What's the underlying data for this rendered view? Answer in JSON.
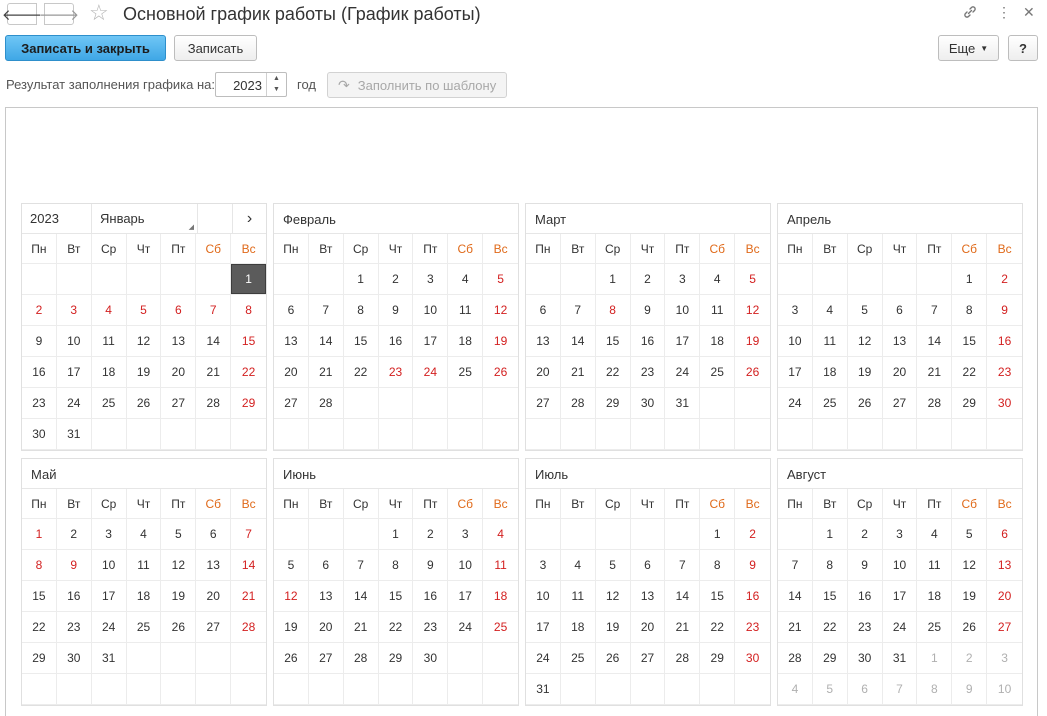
{
  "window": {
    "title": "Основной график работы (График работы)",
    "icons": [
      "back-arrow-icon",
      "forward-arrow-icon",
      "star-icon",
      "link-icon",
      "more-vertical-icon",
      "close-icon"
    ]
  },
  "toolbar": {
    "save_close_label": "Записать и закрыть",
    "save_label": "Записать",
    "more_label": "Еще",
    "help_label": "?"
  },
  "params": {
    "result_label": "Результат заполнения графика на:",
    "year_value": "2023",
    "year_unit": "год",
    "fill_button_label": "Заполнить по шаблону"
  },
  "calendar": {
    "year": "2023",
    "selected_month_label": "Январь",
    "weekdays": [
      "Пн",
      "Вт",
      "Ср",
      "Чт",
      "Пт",
      "Сб",
      "Вс"
    ],
    "colors": {
      "holiday": "#d32020",
      "weekend_header": "#e06a1a",
      "other_month": "#b0b0b0",
      "selected": "#5b5b5b"
    },
    "months": [
      {
        "name": "Январь",
        "start": 6,
        "days": 31,
        "holidays": [
          1,
          2,
          3,
          4,
          5,
          6,
          7,
          8,
          15,
          22,
          29
        ],
        "selected": 1
      },
      {
        "name": "Февраль",
        "start": 2,
        "days": 28,
        "holidays": [
          5,
          12,
          19,
          23,
          24,
          26
        ]
      },
      {
        "name": "Март",
        "start": 2,
        "days": 31,
        "holidays": [
          5,
          8,
          12,
          19,
          26
        ]
      },
      {
        "name": "Апрель",
        "start": 5,
        "days": 30,
        "holidays": [
          2,
          9,
          16,
          23,
          30
        ]
      },
      {
        "name": "Май",
        "start": 0,
        "days": 31,
        "holidays": [
          1,
          7,
          8,
          9,
          14,
          21,
          28
        ]
      },
      {
        "name": "Июнь",
        "start": 3,
        "days": 30,
        "holidays": [
          4,
          11,
          12,
          18,
          25
        ]
      },
      {
        "name": "Июль",
        "start": 5,
        "days": 31,
        "holidays": [
          2,
          9,
          16,
          23,
          30
        ]
      },
      {
        "name": "Август",
        "start": 1,
        "days": 31,
        "holidays": [
          6,
          13,
          20,
          27
        ],
        "trailing": [
          1,
          2,
          3,
          4,
          5,
          6,
          7,
          8,
          9,
          10
        ]
      }
    ]
  }
}
